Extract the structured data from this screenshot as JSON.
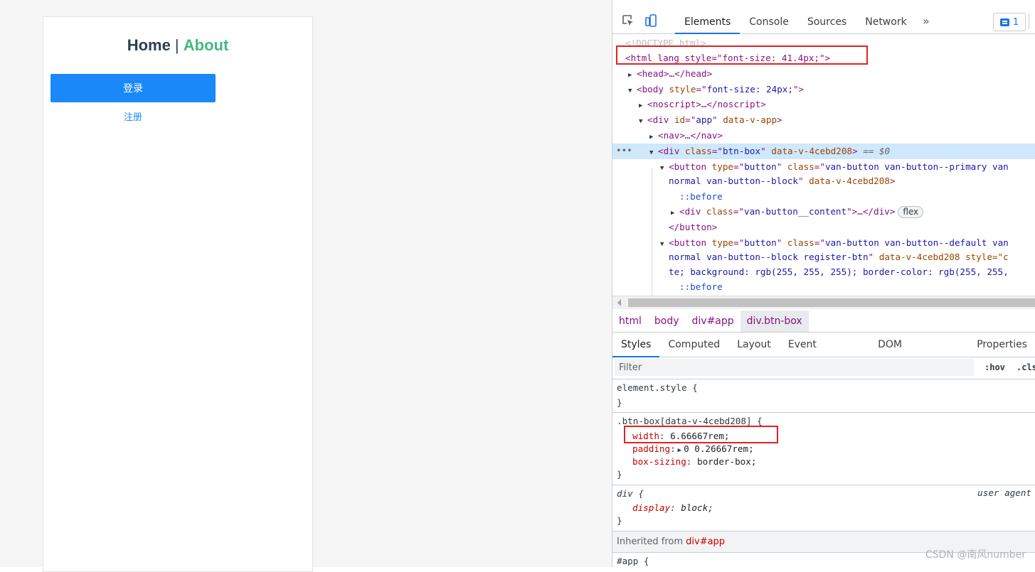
{
  "preview": {
    "nav_home": "Home",
    "nav_sep": " | ",
    "nav_about": "About",
    "login_button": "登录",
    "register_button": "注册"
  },
  "devtools": {
    "tabs": [
      "Elements",
      "Console",
      "Sources",
      "Network"
    ],
    "more": "»",
    "issues_count": "1",
    "dom": {
      "doctype": "<!DOCTYPE html>",
      "html_open": "<html lang style=\"font-size: 41.4px;\">",
      "head": "<head>…</head>",
      "body_tag": "body",
      "body_style": "font-size: 24px;",
      "noscript": "<noscript>…</noscript>",
      "app_tag": "div",
      "app_id": "app",
      "app_attr": "data-v-app",
      "nav": "<nav>…</nav>",
      "btnbox_class": "btn-box",
      "btnbox_attr": "data-v-4cebd208",
      "btnbox_suffix": "== $0",
      "btn1_class_a": "van-button van-button--primary van",
      "btn1_class_b": "normal van-button--block",
      "scope_attr": "data-v-4cebd208",
      "before": "::before",
      "content_class": "van-button__content",
      "content_tail": "…</div>",
      "flex_badge": "flex",
      "button_close": "</button>",
      "btn2_class_a": "van-button van-button--default van",
      "btn2_class_b": "normal van-button--block register-btn",
      "btn2_style_head": "style=\"c",
      "btn2_style_tail": "te; background: rgb(255, 255, 255); border-color: rgb(255, 255,",
      "button_type": "button"
    },
    "breadcrumbs": [
      "html",
      "body",
      "div#app",
      "div.btn-box"
    ],
    "subtabs": [
      "Styles",
      "Computed",
      "Layout",
      "Event Listeners",
      "DOM Breakpoints",
      "Properties"
    ],
    "filter_placeholder": "Filter",
    "hov": ":hov",
    "cls": ".cls",
    "rules": {
      "element_style": "element.style {",
      "close": "}",
      "btnbox_selector": ".btn-box[data-v-4cebd208] {",
      "width_prop": "width",
      "width_val": "6.66667rem;",
      "padding_prop": "padding",
      "padding_val": "0 0.26667rem;",
      "boxsizing_prop": "box-sizing",
      "boxsizing_val": "border-box;",
      "div_selector": "div {",
      "user_agent": "user agent",
      "display_prop": "display",
      "display_val": "block;",
      "inherited_label": "Inherited from ",
      "inherited_sel": "div#app",
      "app_rule": "#app {"
    }
  },
  "watermark": "CSDN @南风number"
}
